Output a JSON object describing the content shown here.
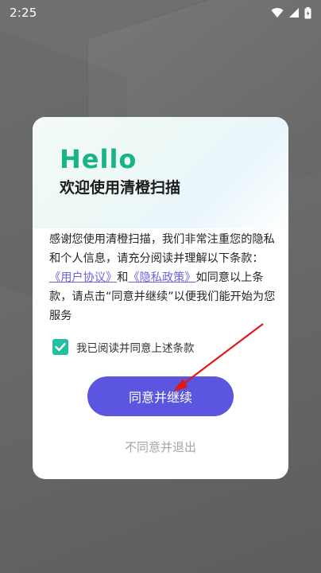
{
  "status_bar": {
    "time": "2:25",
    "icons": [
      "wifi-icon",
      "signal-icon",
      "battery-charging-icon"
    ]
  },
  "dialog": {
    "hello": "Hello",
    "welcome": "欢迎使用清橙扫描",
    "body_prefix": "感谢您使用清橙扫描，我们非常注重您的隐私和个人信息，请充分阅读并理解以下条款：",
    "link_user_agreement": "《用户协议》",
    "and": "和",
    "link_privacy_policy": "《隐私政策》",
    "body_suffix": "如同意以上条款，请点击“同意并继续”以便我们能开始为您服务",
    "agree_checkbox_label": "我已阅读并同意上述条款",
    "agree_checked": true,
    "primary_button": "同意并继续",
    "secondary_button": "不同意并退出"
  },
  "colors": {
    "brand_green": "#18b389",
    "primary_purple": "#5b55e0",
    "link_purple": "#6b63e0",
    "annotation_red": "#e01818"
  }
}
